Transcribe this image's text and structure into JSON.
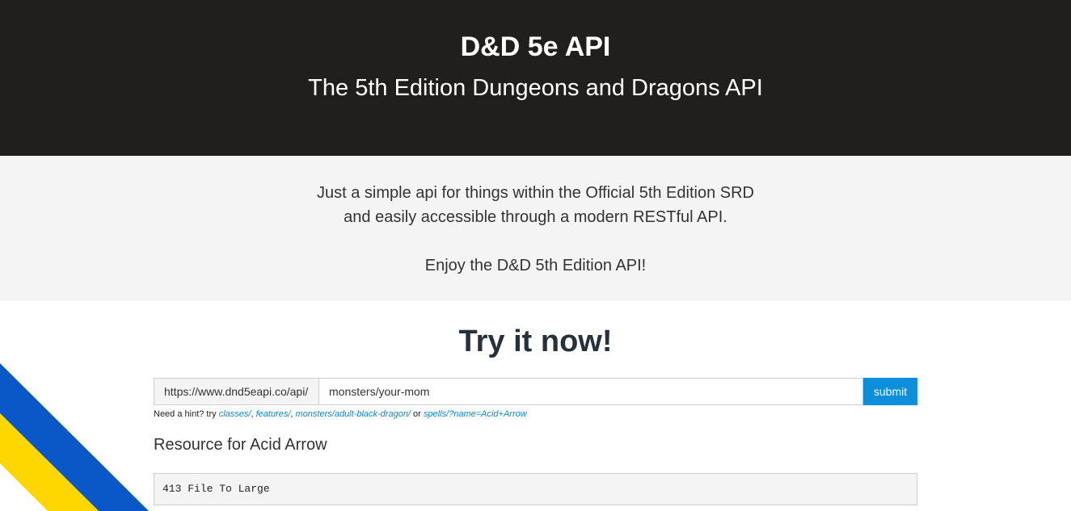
{
  "header": {
    "title": "D&D 5e API",
    "subtitle": "The 5th Edition Dungeons and Dragons API",
    "background": "#211f1e"
  },
  "intro": {
    "line1": "Just a simple api for things within the Official 5th Edition SRD",
    "line2": "and easily accessible through a modern RESTful API.",
    "line3": "Enjoy the D&D 5th Edition API!"
  },
  "try_it": {
    "heading": "Try it now!",
    "url_prefix": "https://www.dnd5eapi.co/api/",
    "input_value": "monsters/your-mom",
    "submit_label": "submit",
    "submit_color": "#0e8fdc"
  },
  "hint": {
    "prefix": "Need a hint? try ",
    "links": [
      "classes/",
      "features/",
      "monsters/adult-black-dragon/",
      "spells/?name=Acid+Arrow"
    ],
    "sep1": ", ",
    "sep2": ", ",
    "sep3": " or "
  },
  "resource": {
    "title": "Resource for Acid Arrow",
    "output": "413 File To Large"
  },
  "ribbon": {
    "blue": "#0a57c8",
    "yellow": "#ffd700"
  }
}
